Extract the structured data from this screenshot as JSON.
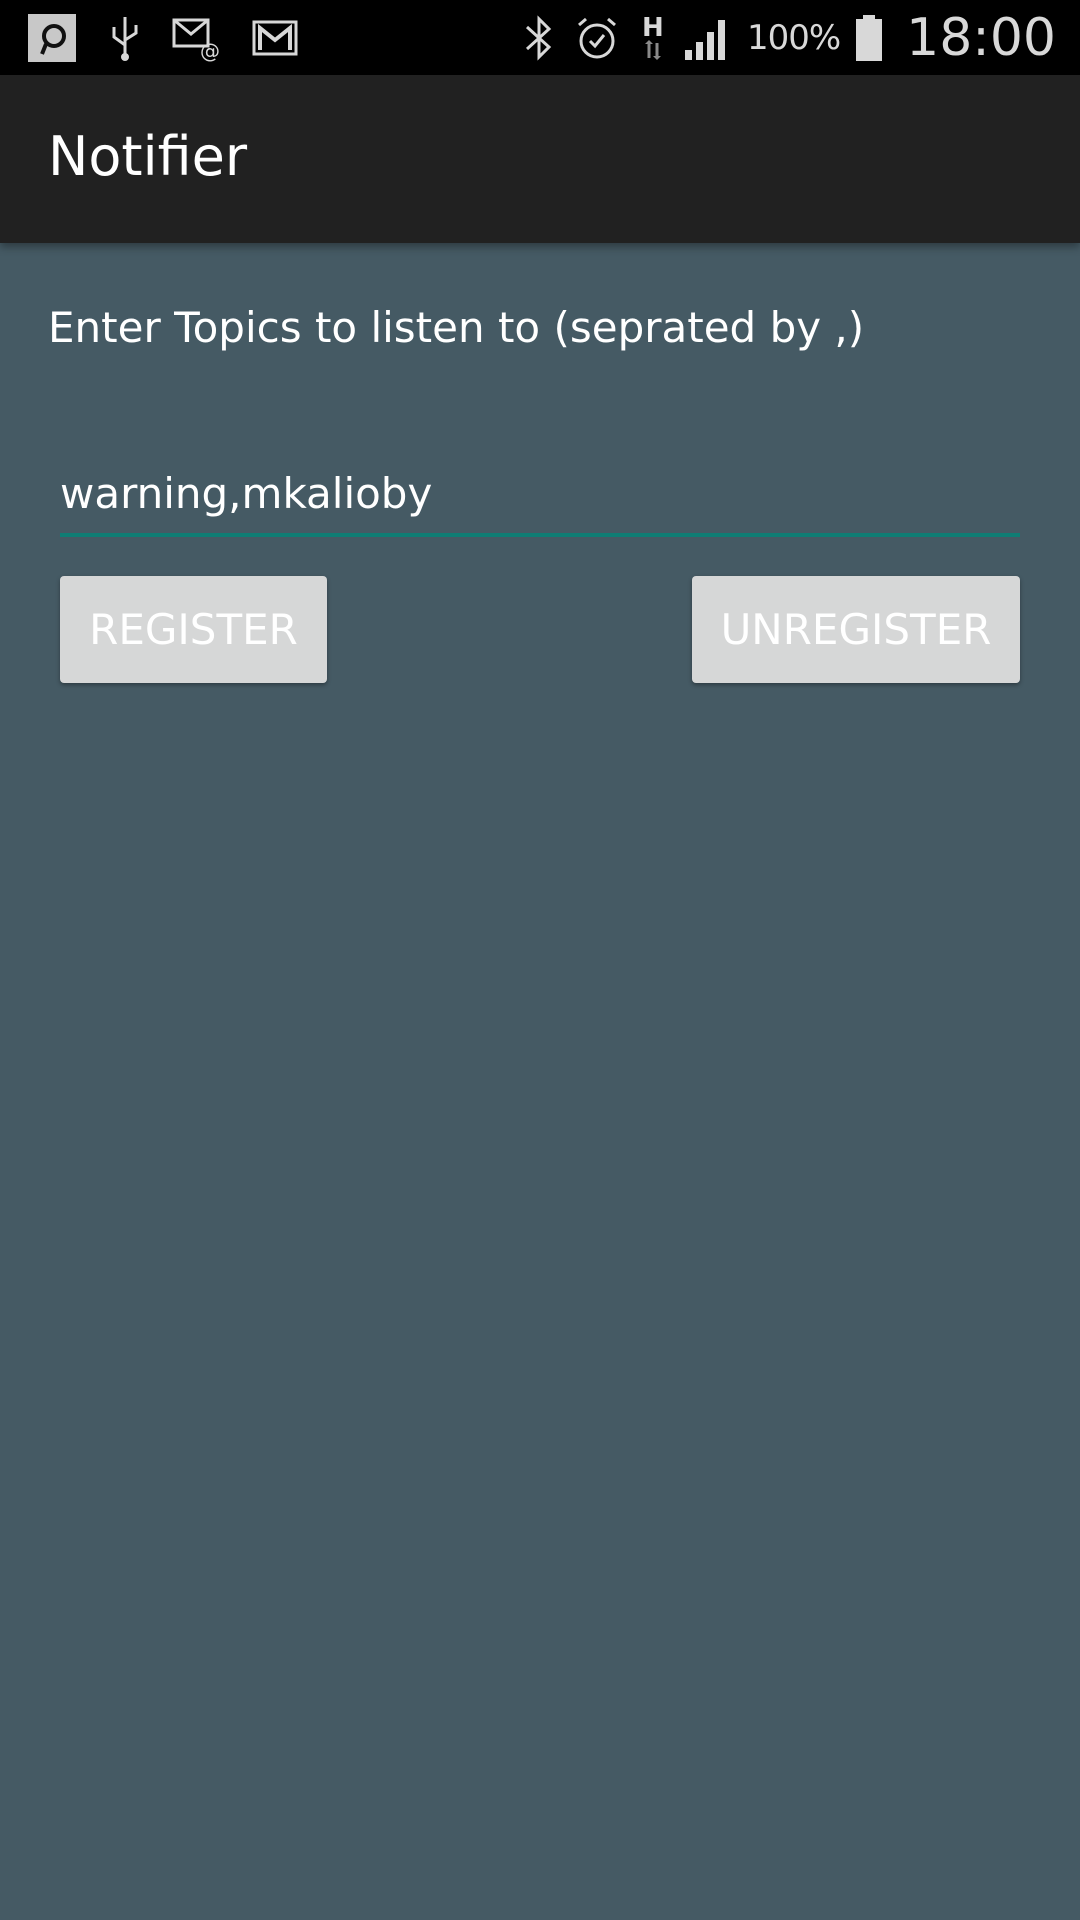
{
  "status_bar": {
    "icons": [
      "app-p-icon",
      "usb-icon",
      "email-icon",
      "gmail-icon",
      "bluetooth-icon",
      "alarm-icon",
      "h-data-icon",
      "signal-icon",
      "battery-icon"
    ],
    "battery": "100%",
    "time": "18:00",
    "data_type": "H"
  },
  "app_bar": {
    "title": "Notifier",
    "background": "#212121"
  },
  "main": {
    "instruction": "Enter Topics to listen to  (seprated by ,)",
    "topics_input": {
      "value": "warning,mkalioby",
      "underline_color": "#0f7d74"
    },
    "register_label": "REGISTER",
    "unregister_label": "UNREGISTER",
    "background": "#455a64"
  }
}
